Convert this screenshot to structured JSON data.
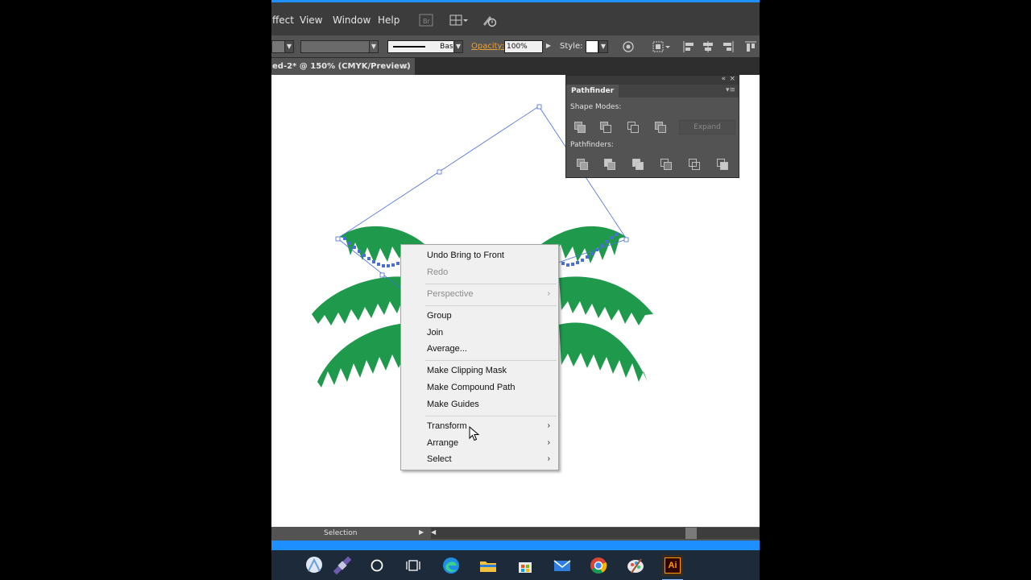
{
  "menubar": {
    "items": [
      "ffect",
      "View",
      "Window",
      "Help"
    ]
  },
  "controlbar": {
    "stroke_profile": "Basic",
    "opacity_label": "Opacity:",
    "opacity_value": "100%",
    "style_label": "Style:"
  },
  "document": {
    "tab_title": "ed-2* @ 150% (CMYK/Preview)",
    "close_glyph": "×"
  },
  "pathfinder": {
    "title": "Pathfinder",
    "shape_modes_label": "Shape Modes:",
    "pathfinders_label": "Pathfinders:",
    "expand_label": "Expand",
    "collapse_glyph": "«",
    "close_glyph": "×"
  },
  "context_menu": {
    "items": [
      {
        "label": "Undo Bring to Front",
        "disabled": false
      },
      {
        "label": "Redo",
        "disabled": true
      },
      {
        "label": "Perspective",
        "disabled": true,
        "submenu": true
      },
      {
        "label": "Group",
        "disabled": false
      },
      {
        "label": "Join",
        "disabled": false
      },
      {
        "label": "Average...",
        "disabled": false
      },
      {
        "label": "Make Clipping Mask",
        "disabled": false
      },
      {
        "label": "Make Compound Path",
        "disabled": false
      },
      {
        "label": "Make Guides",
        "disabled": false
      },
      {
        "label": "Transform",
        "disabled": false,
        "submenu": true
      },
      {
        "label": "Arrange",
        "disabled": false,
        "submenu": true
      },
      {
        "label": "Select",
        "disabled": false,
        "submenu": true
      }
    ]
  },
  "statusbar": {
    "tool_label": "Selection"
  },
  "colors": {
    "leaf_green": "#1f9a4c",
    "selection_blue": "#4a6fd6",
    "taskbar_accent": "#1e8fff"
  },
  "taskbar": {
    "icons": [
      "maps-app-icon",
      "satellite-app-icon",
      "cortana-icon",
      "task-view-icon",
      "edge-icon",
      "file-explorer-icon",
      "store-icon",
      "mail-icon",
      "chrome-icon",
      "paint-icon",
      "illustrator-icon"
    ],
    "illustrator_label": "Ai"
  }
}
